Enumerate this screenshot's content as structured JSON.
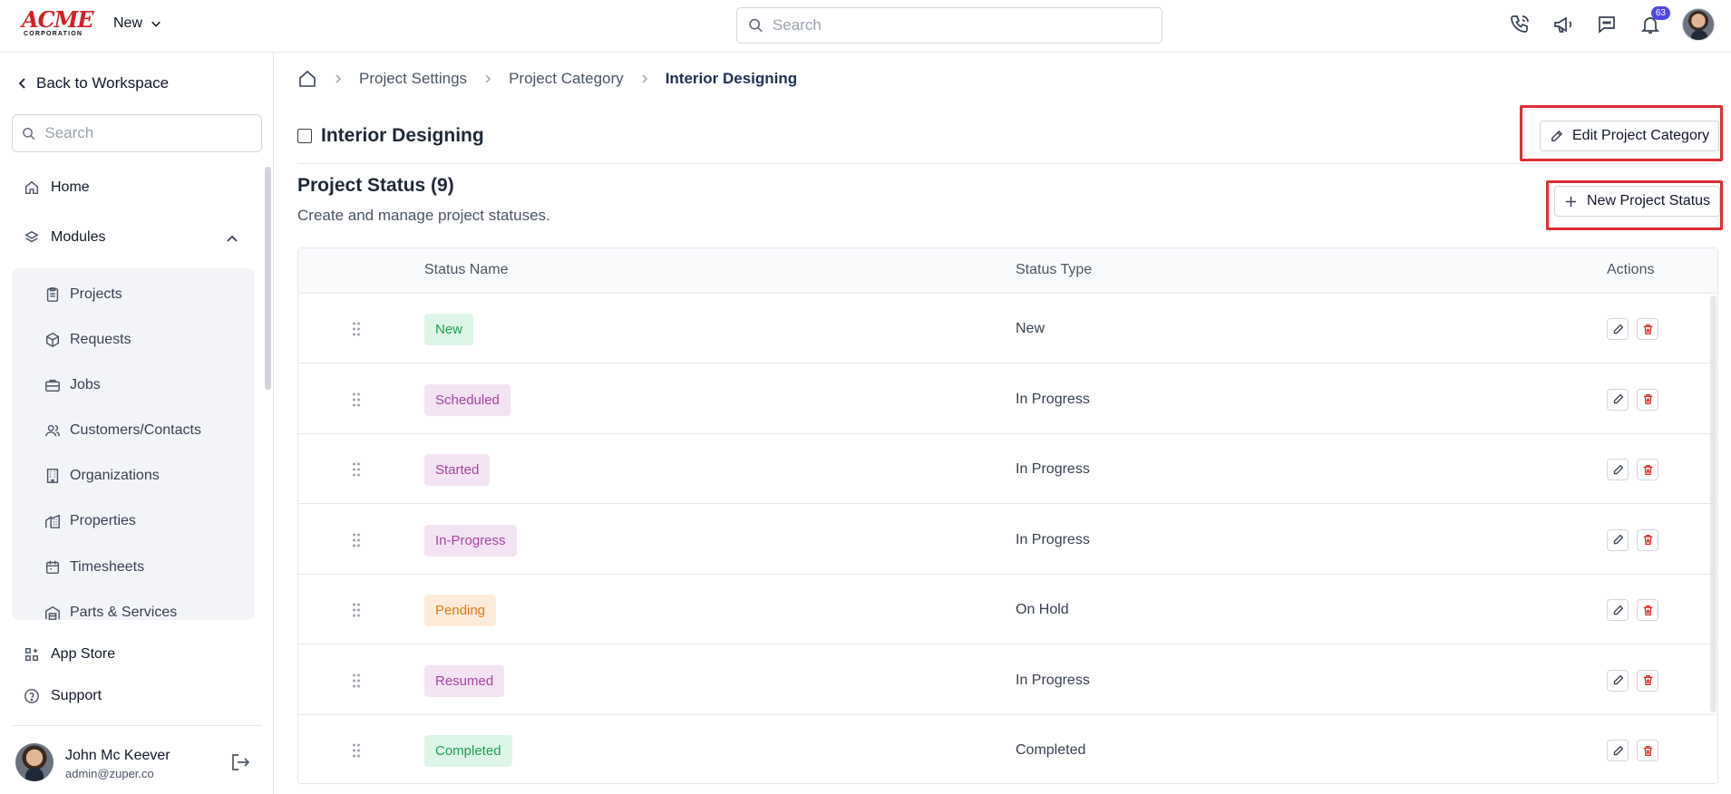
{
  "header": {
    "logo_main": "ACME",
    "logo_sub": "CORPORATION",
    "workspace": "New",
    "search_placeholder": "Search",
    "notifications_count": "63"
  },
  "sidebar": {
    "back_label": "Back to Workspace",
    "search_placeholder": "Search",
    "home": "Home",
    "modules": "Modules",
    "module_items": [
      {
        "label": "Projects",
        "icon": "clipboard-icon"
      },
      {
        "label": "Requests",
        "icon": "box-icon"
      },
      {
        "label": "Jobs",
        "icon": "briefcase-icon"
      },
      {
        "label": "Customers/Contacts",
        "icon": "users-icon"
      },
      {
        "label": "Organizations",
        "icon": "building-icon"
      },
      {
        "label": "Properties",
        "icon": "property-icon"
      },
      {
        "label": "Timesheets",
        "icon": "calendar-icon"
      },
      {
        "label": "Parts & Services",
        "icon": "warehouse-icon"
      }
    ],
    "app_store": "App Store",
    "support": "Support",
    "user": {
      "name": "John Mc Keever",
      "email": "admin@zuper.co"
    }
  },
  "breadcrumb": {
    "items": [
      "Project Settings",
      "Project Category"
    ],
    "current": "Interior Designing"
  },
  "page": {
    "title": "Interior Designing",
    "edit_button": "Edit Project Category",
    "section_title": "Project Status (9)",
    "section_subtitle": "Create and manage project statuses.",
    "new_button": "New Project Status"
  },
  "table": {
    "columns": [
      "Status Name",
      "Status Type",
      "Actions"
    ],
    "rows": [
      {
        "name": "New",
        "type": "New",
        "bg": "#dcf5e7",
        "fg": "#1f9d55"
      },
      {
        "name": "Scheduled",
        "type": "In Progress",
        "bg": "#f3e3f3",
        "fg": "#a3449f"
      },
      {
        "name": "Started",
        "type": "In Progress",
        "bg": "#f3e3f3",
        "fg": "#a3449f"
      },
      {
        "name": "In-Progress",
        "type": "In Progress",
        "bg": "#f3e3f3",
        "fg": "#a3449f"
      },
      {
        "name": "Pending",
        "type": "On Hold",
        "bg": "#fdebd9",
        "fg": "#e07b16"
      },
      {
        "name": "Resumed",
        "type": "In Progress",
        "bg": "#f3e3f3",
        "fg": "#a3449f"
      },
      {
        "name": "Completed",
        "type": "Completed",
        "bg": "#dcf5e7",
        "fg": "#1f9d55"
      }
    ]
  },
  "colors": {
    "highlight": "#dc2f34",
    "delete": "#dc2626",
    "badge": "#4f46e5"
  }
}
